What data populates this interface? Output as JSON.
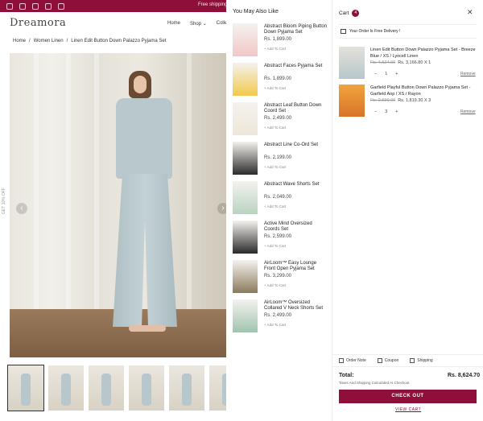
{
  "announcement": "Free shipping",
  "header": {
    "logo": "Dreamora",
    "nav": [
      "Home",
      "Shop ⌄",
      "Colle"
    ]
  },
  "breadcrumb": [
    "Home",
    "/",
    "Women Linen",
    "/",
    "Linen Edit Button Down Palazzo Pyjama Set"
  ],
  "sidebar_vertical_text": "GET 10% OFF",
  "recommendations": {
    "heading": "You May Also Like",
    "add_label": "+ Add To Cart",
    "items": [
      {
        "name": "Abstract Bloom Piping Button Down Pyjama Set",
        "price": "Rs. 1,899.00",
        "color": "#f3c6c8"
      },
      {
        "name": "Abstract Faces Pyjama Set",
        "price": "Rs. 1,899.00",
        "color": "#f2c94c"
      },
      {
        "name": "Abstract Leaf Button Down Coord Set",
        "price": "Rs. 2,499.00",
        "color": "#efe6d8"
      },
      {
        "name": "Abstract Line Co-Ord Set",
        "price": "Rs. 2,199.00",
        "color": "#2b2b2b"
      },
      {
        "name": "Abstract Wave Shorts Set",
        "price": "Rs. 2,049.00",
        "color": "#b8d3c0"
      },
      {
        "name": "Active Mind Oversized Coords Set",
        "price": "Rs. 2,599.00",
        "color": "#2a2a2a"
      },
      {
        "name": "AirLoom™ Easy Lounge Front Open Pyjama Set",
        "price": "Rs. 3,299.00",
        "color": "#8a7a5c"
      },
      {
        "name": "AirLoom™ Oversized Collared V Neck Shorts Set",
        "price": "Rs. 2,499.00",
        "color": "#9fc4ae"
      }
    ]
  },
  "cart": {
    "title": "Cart",
    "count": "4",
    "close": "✕",
    "free_delivery": "Your Order Is Free Delivery !",
    "items": [
      {
        "name": "Linen Edit Button Down Palazzo Pyjama Set - Breeze Blue / XS / Lyocell Linen",
        "old": "Rs. 4,524.00",
        "new": "Rs. 3,166.80 X 1",
        "qty": "1",
        "remove": "Remove",
        "color": "#b8c7cb"
      },
      {
        "name": "Garfield Playful Button Down Palazzo Pyjama Set - Garfield Aop / XS / Rayon",
        "old": "Rs. 2,599.00",
        "new": "Rs. 1,819.30 X 3",
        "qty": "3",
        "remove": "Remove",
        "color": "#e98d2a"
      }
    ],
    "tools": [
      "Order Note",
      "Coupon",
      "Shipping"
    ],
    "total_label": "Total:",
    "total_value": "Rs. 8,624.70",
    "tax_note": "Taxes And Shipping Calculated At Checkout",
    "checkout": "CHECK OUT",
    "view_cart": "VIEW CART"
  },
  "colors": {
    "brand": "#8e0f3a"
  }
}
